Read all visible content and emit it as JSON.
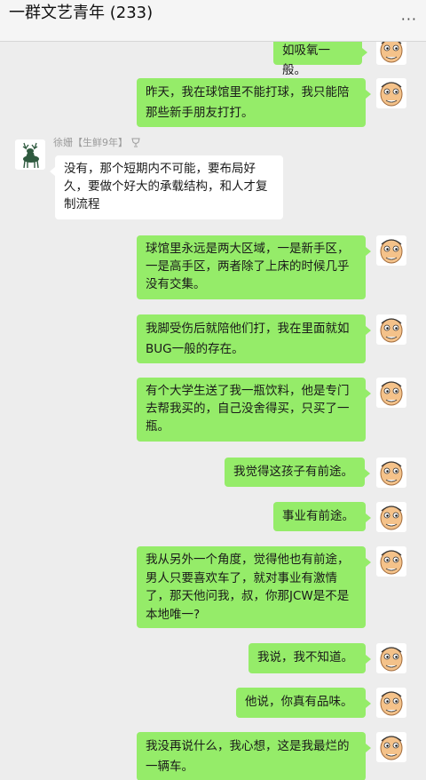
{
  "header": {
    "title": "一群文艺青年 (233)",
    "more_label": "···"
  },
  "sender": {
    "name": "徐姗【生鲜9年】"
  },
  "messages": [
    {
      "side": "mine",
      "text": "如吸氧一般。"
    },
    {
      "side": "mine",
      "text": "昨天，我在球馆里不能打球，我只能陪那些新手朋友打打。"
    },
    {
      "side": "theirs",
      "text": "没有，那个短期内不可能，要布局好久，要做个好大的承载结构，和人才复制流程"
    },
    {
      "side": "mine",
      "text": "球馆里永远是两大区域，一是新手区，一是高手区，两者除了上床的时候几乎没有交集。"
    },
    {
      "side": "mine",
      "text": "我脚受伤后就陪他们打，我在里面就如BUG一般的存在。"
    },
    {
      "side": "mine",
      "text": "有个大学生送了我一瓶饮料，他是专门去帮我买的，自己没舍得买，只买了一瓶。"
    },
    {
      "side": "mine",
      "text": "我觉得这孩子有前途。"
    },
    {
      "side": "mine",
      "text": "事业有前途。"
    },
    {
      "side": "mine",
      "text": "我从另外一个角度，觉得他也有前途，男人只要喜欢车了，就对事业有激情了，那天他问我，叔，你那JCW是不是本地唯一?"
    },
    {
      "side": "mine",
      "text": "我说，我不知道。"
    },
    {
      "side": "mine",
      "text": "他说，你真有品味。"
    },
    {
      "side": "mine",
      "text": "我没再说什么，我心想，这是我最烂的一辆车。"
    }
  ],
  "colors": {
    "mine_bubble": "#95ec69",
    "theirs_bubble": "#ffffff",
    "background": "#ededed"
  }
}
